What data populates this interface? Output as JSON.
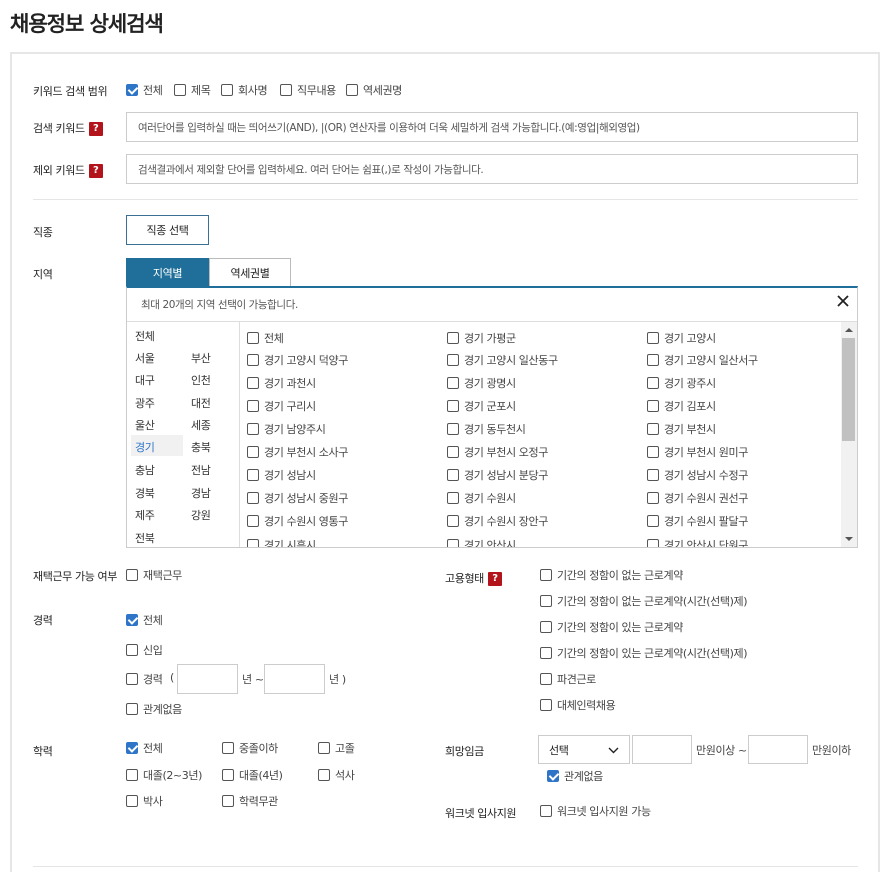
{
  "page": {
    "title": "채용정보 상세검색"
  },
  "keyword_scope": {
    "label": "키워드 검색 범위",
    "options": [
      {
        "label": "전체",
        "checked": true
      },
      {
        "label": "제목",
        "checked": false
      },
      {
        "label": "회사명",
        "checked": false
      },
      {
        "label": "직무내용",
        "checked": false
      },
      {
        "label": "역세권명",
        "checked": false
      }
    ]
  },
  "search_keyword": {
    "label": "검색 키워드",
    "help": "?",
    "placeholder": "여러단어를 입력하실 때는 띄어쓰기(AND), |(OR) 연산자를 이용하여 더욱 세밀하게 검색 가능합니다.(예:영업|해외영업)"
  },
  "exclude_keyword": {
    "label": "제외 키워드",
    "help": "?",
    "placeholder": "검색결과에서 제외할 단어를 입력하세요. 여러 단어는 쉼표(,)로 작성이 가능합니다."
  },
  "job_type": {
    "label": "직종",
    "button": "직종 선택"
  },
  "region": {
    "label": "지역",
    "tabs": [
      {
        "label": "지역별",
        "active": true
      },
      {
        "label": "역세권별",
        "active": false
      }
    ],
    "notice": "최대 20개의 지역 선택이 가능합니다.",
    "close_icon": "close-icon",
    "left_all": "전체",
    "left_pairs": [
      [
        "서울",
        "부산"
      ],
      [
        "대구",
        "인천"
      ],
      [
        "광주",
        "대전"
      ],
      [
        "울산",
        "세종"
      ],
      [
        "경기",
        "충북"
      ],
      [
        "충남",
        "전남"
      ],
      [
        "경북",
        "경남"
      ],
      [
        "제주",
        "강원"
      ]
    ],
    "left_last": "전북",
    "selected": "경기",
    "sub_rows": [
      [
        "전체",
        "경기 가평군",
        "경기 고양시"
      ],
      [
        "경기 고양시 덕양구",
        "경기 고양시 일산동구",
        "경기 고양시 일산서구"
      ],
      [
        "경기 과천시",
        "경기 광명시",
        "경기 광주시"
      ],
      [
        "경기 구리시",
        "경기 군포시",
        "경기 김포시"
      ],
      [
        "경기 남양주시",
        "경기 동두천시",
        "경기 부천시"
      ],
      [
        "경기 부천시 소사구",
        "경기 부천시 오정구",
        "경기 부천시 원미구"
      ],
      [
        "경기 성남시",
        "경기 성남시 분당구",
        "경기 성남시 수정구"
      ],
      [
        "경기 성남시 중원구",
        "경기 수원시",
        "경기 수원시 권선구"
      ],
      [
        "경기 수원시 영통구",
        "경기 수원시 장안구",
        "경기 수원시 팔달구"
      ],
      [
        "경기 시흥시",
        "경기 안산시",
        "경기 안산시 단원구"
      ]
    ]
  },
  "remote": {
    "label": "재택근무 가능 여부",
    "option": "재택근무",
    "checked": false
  },
  "career": {
    "label": "경력",
    "all": "전체",
    "all_checked": true,
    "new": "신입",
    "experienced": "경력",
    "paren_open": "(",
    "year_from_unit": "년 ~",
    "year_to_unit": "년 )",
    "none": "관계없음"
  },
  "education": {
    "label": "학력",
    "options": [
      {
        "label": "전체",
        "checked": true
      },
      {
        "label": "중졸이하",
        "checked": false
      },
      {
        "label": "고졸",
        "checked": false
      },
      {
        "label": "대졸(2~3년)",
        "checked": false
      },
      {
        "label": "대졸(4년)",
        "checked": false
      },
      {
        "label": "석사",
        "checked": false
      },
      {
        "label": "박사",
        "checked": false
      },
      {
        "label": "학력무관",
        "checked": false
      }
    ]
  },
  "employment_type": {
    "label": "고용형태",
    "help": "?",
    "options": [
      "기간의 정함이 없는 근로계약",
      "기간의 정함이 없는 근로계약(시간(선택)제)",
      "기간의 정함이 있는 근로계약",
      "기간의 정함이 있는 근로계약(시간(선택)제)",
      "파견근로",
      "대체인력채용"
    ]
  },
  "salary": {
    "label": "희망임금",
    "select": "선택",
    "min_unit": "만원이상 ~",
    "max_unit": "만원이하",
    "none": "관계없음",
    "none_checked": true
  },
  "worknet": {
    "label": "워크넷 입사지원",
    "option": "워크넷 입사지원 가능",
    "checked": false
  },
  "colors": {
    "accent": "#2e75c8",
    "tab_active": "#1f6f9a",
    "help_red": "#b3131b"
  }
}
